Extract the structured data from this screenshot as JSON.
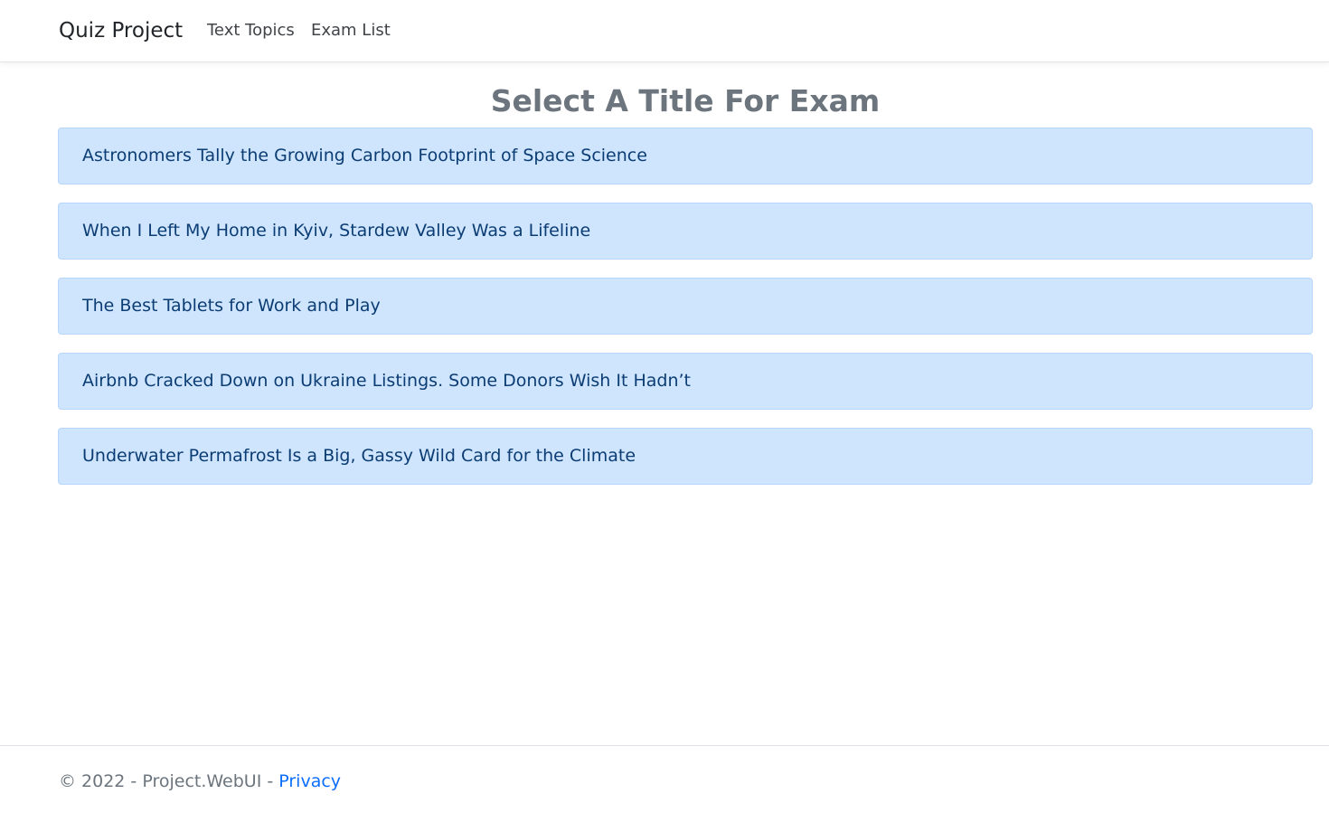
{
  "navbar": {
    "brand": "Quiz Project",
    "links": [
      {
        "label": "Text Topics"
      },
      {
        "label": "Exam List"
      }
    ]
  },
  "main": {
    "title": "Select A Title For Exam",
    "exams": [
      {
        "title": "Astronomers Tally the Growing Carbon Footprint of Space Science"
      },
      {
        "title": "When I Left My Home in Kyiv, Stardew Valley Was a Lifeline"
      },
      {
        "title": "The Best Tablets for Work and Play"
      },
      {
        "title": "Airbnb Cracked Down on Ukraine Listings. Some Donors Wish It Hadn’t"
      },
      {
        "title": "Underwater Permafrost Is a Big, Gassy Wild Card for the Climate"
      }
    ]
  },
  "footer": {
    "copyright": "© 2022 - Project.WebUI - ",
    "privacy_label": "Privacy"
  },
  "colors": {
    "item_background": "#cfe5fd",
    "item_text": "#0b3d74",
    "link_blue": "#0d6efd",
    "muted_text": "#6c757d"
  }
}
